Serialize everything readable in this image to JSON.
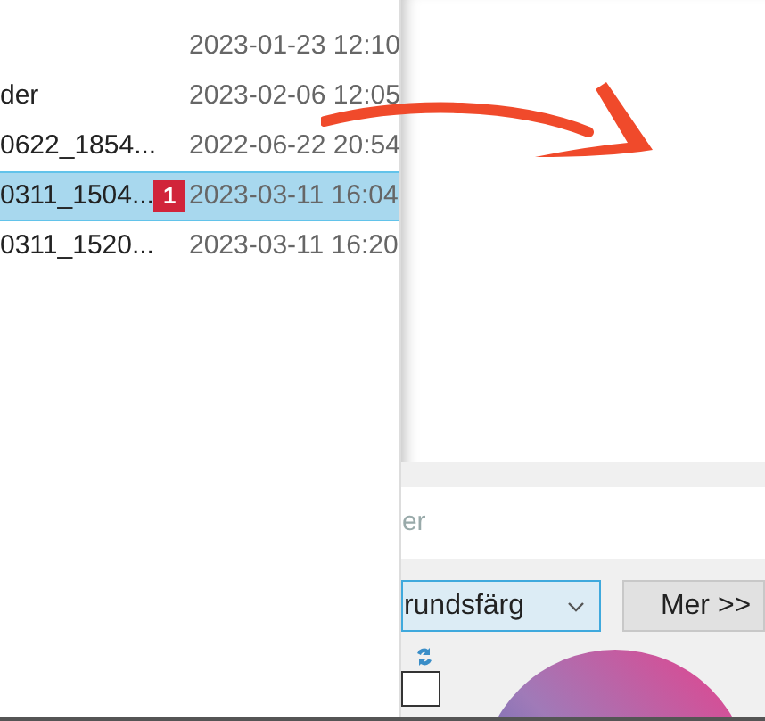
{
  "file_list": {
    "rows": [
      {
        "name": "",
        "date": "2023-01-23 12:10",
        "selected": false
      },
      {
        "name": "der",
        "date": "2023-02-06 12:05",
        "selected": false
      },
      {
        "name": "0622_1854...",
        "date": "2022-06-22 20:54",
        "selected": false
      },
      {
        "name": "0311_1504...",
        "date": "2023-03-11 16:04",
        "selected": true,
        "badge": "1"
      },
      {
        "name": "0311_1520...",
        "date": "2023-03-11 16:20",
        "selected": false
      }
    ]
  },
  "color_dialog": {
    "field_text": "er",
    "dropdown": {
      "value": "rundsfärg"
    },
    "more_button": "Mer >>"
  }
}
